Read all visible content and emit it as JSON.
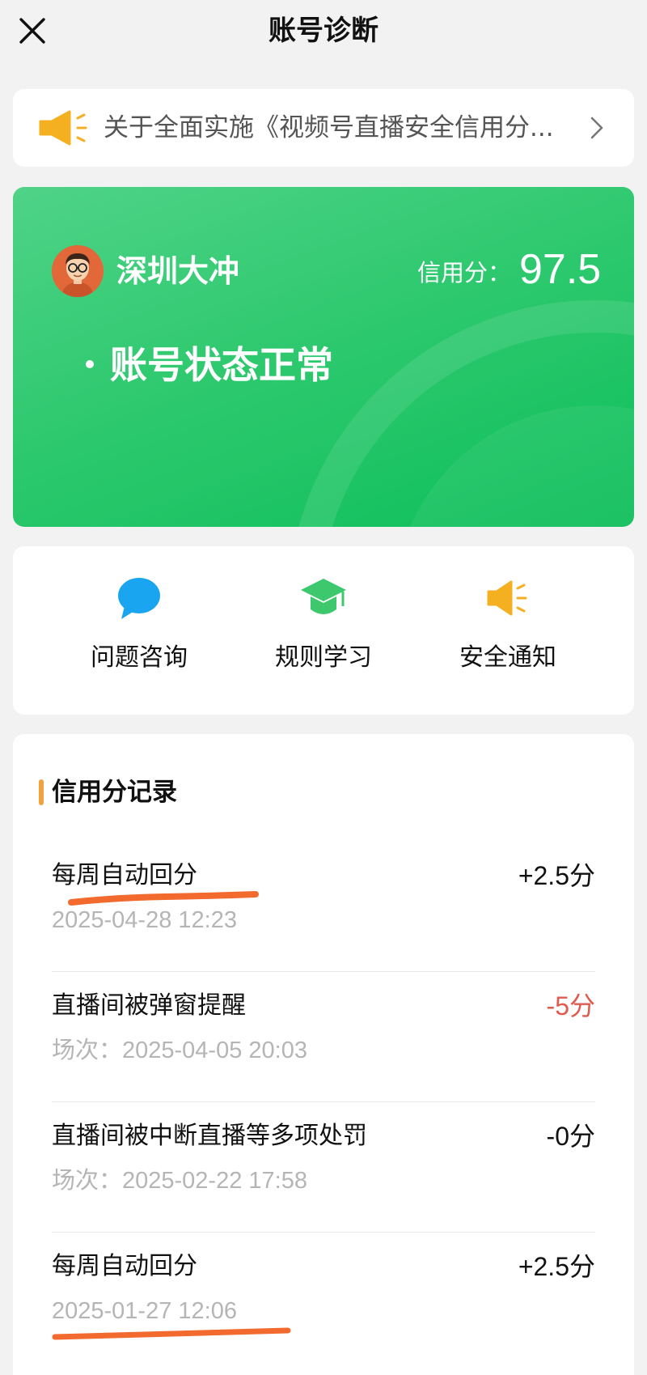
{
  "header": {
    "title": "账号诊断",
    "close_icon": "close-icon"
  },
  "notice": {
    "text": "关于全面实施《视频号直播安全信用分...",
    "icon": "megaphone-icon",
    "chevron": "chevron-right-icon"
  },
  "status": {
    "username": "深圳大冲",
    "credit_label": "信用分：",
    "credit_score": "97.5",
    "account_status": "账号状态正常"
  },
  "actions": [
    {
      "label": "问题咨询",
      "icon": "chat-bubble-icon",
      "color": "#1aa5f0"
    },
    {
      "label": "规则学习",
      "icon": "graduation-cap-icon",
      "color": "#3ec86d"
    },
    {
      "label": "安全通知",
      "icon": "megaphone-icon",
      "color": "#f5b021"
    }
  ],
  "records": {
    "title": "信用分记录",
    "items": [
      {
        "title": "每周自动回分",
        "delta": "+2.5分",
        "sub": "2025-04-28 12:23"
      },
      {
        "title": "直播间被弹窗提醒",
        "delta": "-5分",
        "sub": "场次：2025-04-05 20:03"
      },
      {
        "title": "直播间被中断直播等多项处罚",
        "delta": "-0分",
        "sub": "场次：2025-02-22 17:58"
      },
      {
        "title": "每周自动回分",
        "delta": "+2.5分",
        "sub": "2025-01-27 12:06"
      }
    ]
  },
  "colors": {
    "accent_green": "#2fc96f",
    "negative_red": "#e05a4e",
    "annotation_orange": "#f26a2e",
    "section_bar": "#f0a23c"
  }
}
